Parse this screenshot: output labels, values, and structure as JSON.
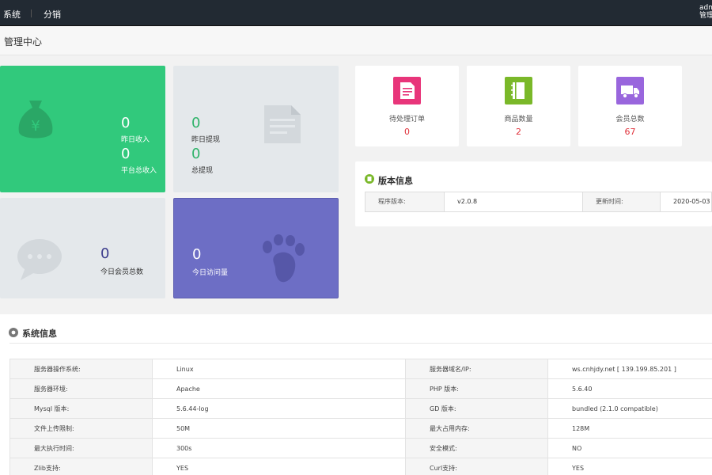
{
  "topbar": {
    "nav": [
      "系统",
      "分销"
    ],
    "user_line1": "admin",
    "user_line2": "管理员"
  },
  "page_title": "管理中心",
  "cards": {
    "income": {
      "yesterday_value": "0",
      "yesterday_label": "昨日收入",
      "total_value": "0",
      "total_label": "平台总收入"
    },
    "withdraw": {
      "yesterday_value": "0",
      "yesterday_label": "昨日提现",
      "total_value": "0",
      "total_label": "总提现"
    },
    "members": {
      "value": "0",
      "label": "今日会员总数"
    },
    "visits": {
      "value": "0",
      "label": "今日访问量"
    }
  },
  "stats": [
    {
      "label": "待处理订单",
      "value": "0",
      "icon": "order-document-icon",
      "color": "#e8357a"
    },
    {
      "label": "商品数量",
      "value": "2",
      "icon": "notebook-icon",
      "color": "#7ab829"
    },
    {
      "label": "会员总数",
      "value": "67",
      "icon": "truck-icon",
      "color": "#9966dd"
    }
  ],
  "version": {
    "title": "版本信息",
    "program_label": "程序版本:",
    "program_value": "v2.0.8",
    "update_label": "更新时间:",
    "update_value": "2020-05-03"
  },
  "system": {
    "title": "系统信息",
    "rows": [
      [
        "服务器操作系统:",
        "Linux",
        "服务器域名/IP:",
        "ws.cnhjdy.net [ 139.199.85.201 ]"
      ],
      [
        "服务器环境:",
        "Apache",
        "PHP 版本:",
        "5.6.40"
      ],
      [
        "Mysql 版本:",
        "5.6.44-log",
        "GD 版本:",
        "bundled (2.1.0 compatible)"
      ],
      [
        "文件上传限制:",
        "50M",
        "最大占用内存:",
        "128M"
      ],
      [
        "最大执行时间:",
        "300s",
        "安全模式:",
        "NO"
      ],
      [
        "Zlib支持:",
        "YES",
        "Curl支持:",
        "YES"
      ]
    ]
  },
  "colors": {
    "topbar": "#222a33",
    "green_card": "#31c97c",
    "purple_card": "#6d6ec5",
    "value_red": "#e0313b"
  }
}
